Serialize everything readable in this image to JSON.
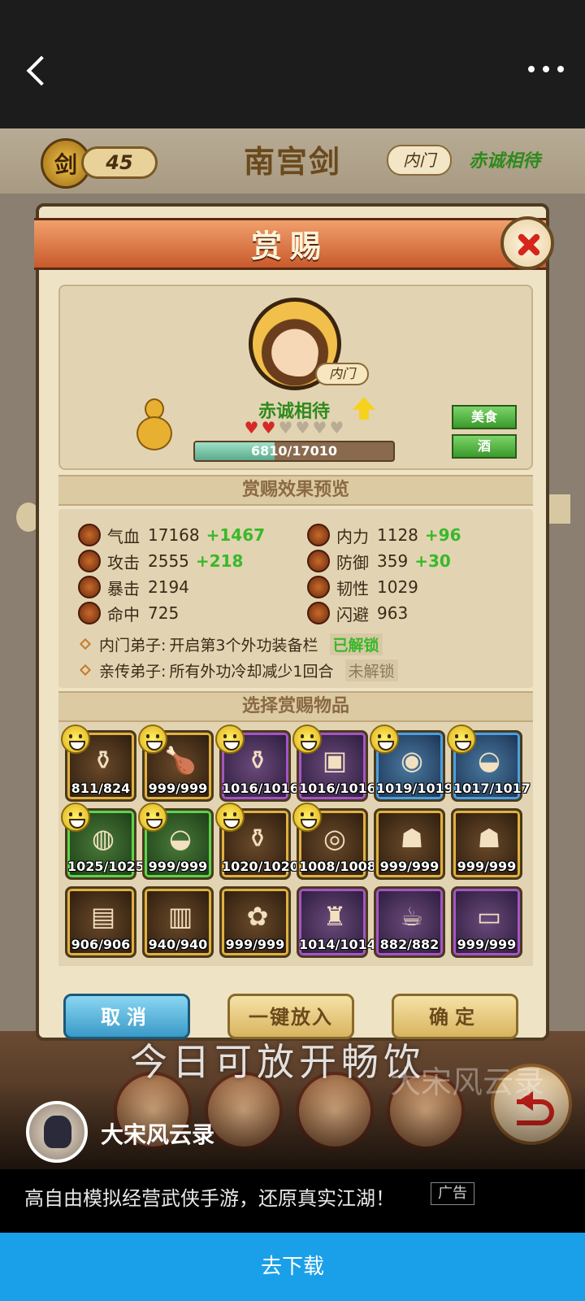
{
  "game": {
    "level_icon": "剑",
    "level": "45",
    "title": "南宫剑",
    "tag": "内门",
    "status": "赤诚相待"
  },
  "dialog": {
    "title": "赏赐",
    "profile": {
      "tag": "内门",
      "status": "赤诚相待",
      "hearts_filled": 2,
      "hearts_total": 6,
      "progress_text": "6810/17010",
      "progress_ratio": 0.4,
      "buttons": [
        "美食",
        "酒"
      ]
    },
    "preview_title": "赏赐效果预览",
    "stats": [
      {
        "name": "气血",
        "value": "17168",
        "bonus": "+1467"
      },
      {
        "name": "内力",
        "value": "1128",
        "bonus": "+96"
      },
      {
        "name": "攻击",
        "value": "2555",
        "bonus": "+218"
      },
      {
        "name": "防御",
        "value": "359",
        "bonus": "+30"
      },
      {
        "name": "暴击",
        "value": "2194",
        "bonus": ""
      },
      {
        "name": "韧性",
        "value": "1029",
        "bonus": ""
      },
      {
        "name": "命中",
        "value": "725",
        "bonus": ""
      },
      {
        "name": "闪避",
        "value": "963",
        "bonus": ""
      }
    ],
    "perks": [
      {
        "label": "内门弟子:",
        "desc": "开启第3个外功装备栏",
        "state": "已解锁",
        "unlocked": true
      },
      {
        "label": "亲传弟子:",
        "desc": "所有外功冷却减少1回合",
        "state": "未解锁",
        "unlocked": false
      }
    ],
    "items_title": "选择赏赐物品",
    "items": [
      {
        "count": "811/824",
        "icon": "gourd-icon",
        "glyph": "⚱",
        "rarity": "gold",
        "smiley": true
      },
      {
        "count": "999/999",
        "icon": "roast-chicken-icon",
        "glyph": "🍗",
        "rarity": "gold",
        "smiley": true
      },
      {
        "count": "1016/1016",
        "icon": "vase-icon",
        "glyph": "⚱",
        "rarity": "purple",
        "smiley": true
      },
      {
        "count": "1016/1016",
        "icon": "braised-pork-icon",
        "glyph": "▣",
        "rarity": "purple",
        "smiley": true
      },
      {
        "count": "1019/1019",
        "icon": "milk-bottle-icon",
        "glyph": "◉",
        "rarity": "blue",
        "smiley": true
      },
      {
        "count": "1017/1017",
        "icon": "soup-bowl-icon",
        "glyph": "◒",
        "rarity": "blue",
        "smiley": true
      },
      {
        "count": "1025/1025",
        "icon": "jar-icon",
        "glyph": "◍",
        "rarity": "green",
        "smiley": true
      },
      {
        "count": "999/999",
        "icon": "dumpling-bowl-icon",
        "glyph": "◒",
        "rarity": "green",
        "smiley": true
      },
      {
        "count": "1020/1020",
        "icon": "wine-jar-icon",
        "glyph": "⚱",
        "rarity": "gold",
        "smiley": true
      },
      {
        "count": "1008/1008",
        "icon": "buns-icon",
        "glyph": "◎",
        "rarity": "gold",
        "smiley": true
      },
      {
        "count": "999/999",
        "icon": "robe-icon",
        "glyph": "☗",
        "rarity": "gold",
        "smiley": false
      },
      {
        "count": "999/999",
        "icon": "robe-icon",
        "glyph": "☗",
        "rarity": "gold",
        "smiley": false
      },
      {
        "count": "906/906",
        "icon": "chest-icon",
        "glyph": "▤",
        "rarity": "gold",
        "smiley": false
      },
      {
        "count": "940/940",
        "icon": "book-icon",
        "glyph": "▥",
        "rarity": "gold",
        "smiley": false
      },
      {
        "count": "999/999",
        "icon": "flowers-icon",
        "glyph": "✿",
        "rarity": "gold",
        "smiley": false
      },
      {
        "count": "1014/1014",
        "icon": "armor-icon",
        "glyph": "♜",
        "rarity": "purple",
        "smiley": false
      },
      {
        "count": "882/882",
        "icon": "teapot-icon",
        "glyph": "☕",
        "rarity": "purple",
        "smiley": false
      },
      {
        "count": "999/999",
        "icon": "gift-box-icon",
        "glyph": "▭",
        "rarity": "purple",
        "smiley": false
      }
    ],
    "buttons": {
      "cancel": "取消",
      "onekey": "一键放入",
      "confirm": "确定"
    }
  },
  "video": {
    "subtitle": "今日可放开畅饮",
    "watermark": "大宋风云录"
  },
  "ad": {
    "name": "大宋风云录",
    "desc": "高自由模拟经营武侠手游，还原真实江湖！",
    "badge": "广告",
    "cta": "去下载"
  }
}
